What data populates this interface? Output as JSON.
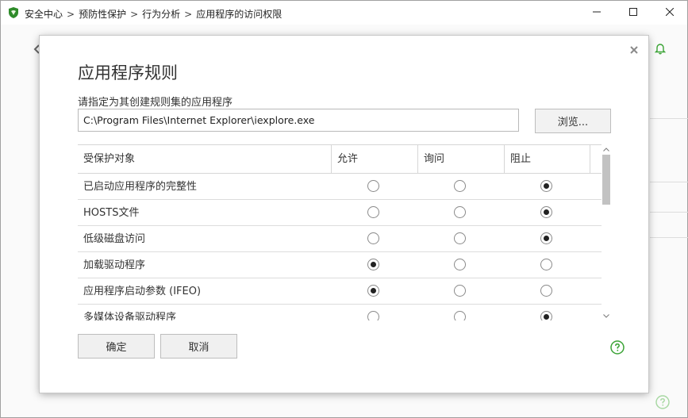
{
  "titlebar": {
    "breadcrumb": [
      "安全中心",
      "预防性保护",
      "行为分析",
      "应用程序的访问权限"
    ],
    "separator": ">"
  },
  "colors": {
    "accent_green": "#3aa335",
    "icon_gray": "#8a8a8a"
  },
  "dialog": {
    "title": "应用程序规则",
    "path_label": "请指定为其创建规则集的应用程序",
    "path_value": "C:\\Program Files\\Internet Explorer\\iexplore.exe",
    "browse_label": "浏览...",
    "table": {
      "headers": [
        "受保护对象",
        "允许",
        "询问",
        "阻止"
      ],
      "rows": [
        {
          "name": "已启动应用程序的完整性",
          "selected": "阻止"
        },
        {
          "name": "HOSTS文件",
          "selected": "阻止"
        },
        {
          "name": "低级磁盘访问",
          "selected": "阻止"
        },
        {
          "name": "加载驱动程序",
          "selected": "允许"
        },
        {
          "name": "应用程序启动参数 (IFEO)",
          "selected": "允许"
        },
        {
          "name": "多媒体设备驱动程序",
          "selected": "阻止"
        }
      ]
    },
    "ok_label": "确定",
    "cancel_label": "取消"
  },
  "icons": {
    "app": "shield-logo-icon",
    "back": "back-arrow-icon",
    "bell": "bell-icon",
    "help": "help-icon",
    "close": "close-icon",
    "minimize": "minimize-icon",
    "maximize": "maximize-icon"
  }
}
